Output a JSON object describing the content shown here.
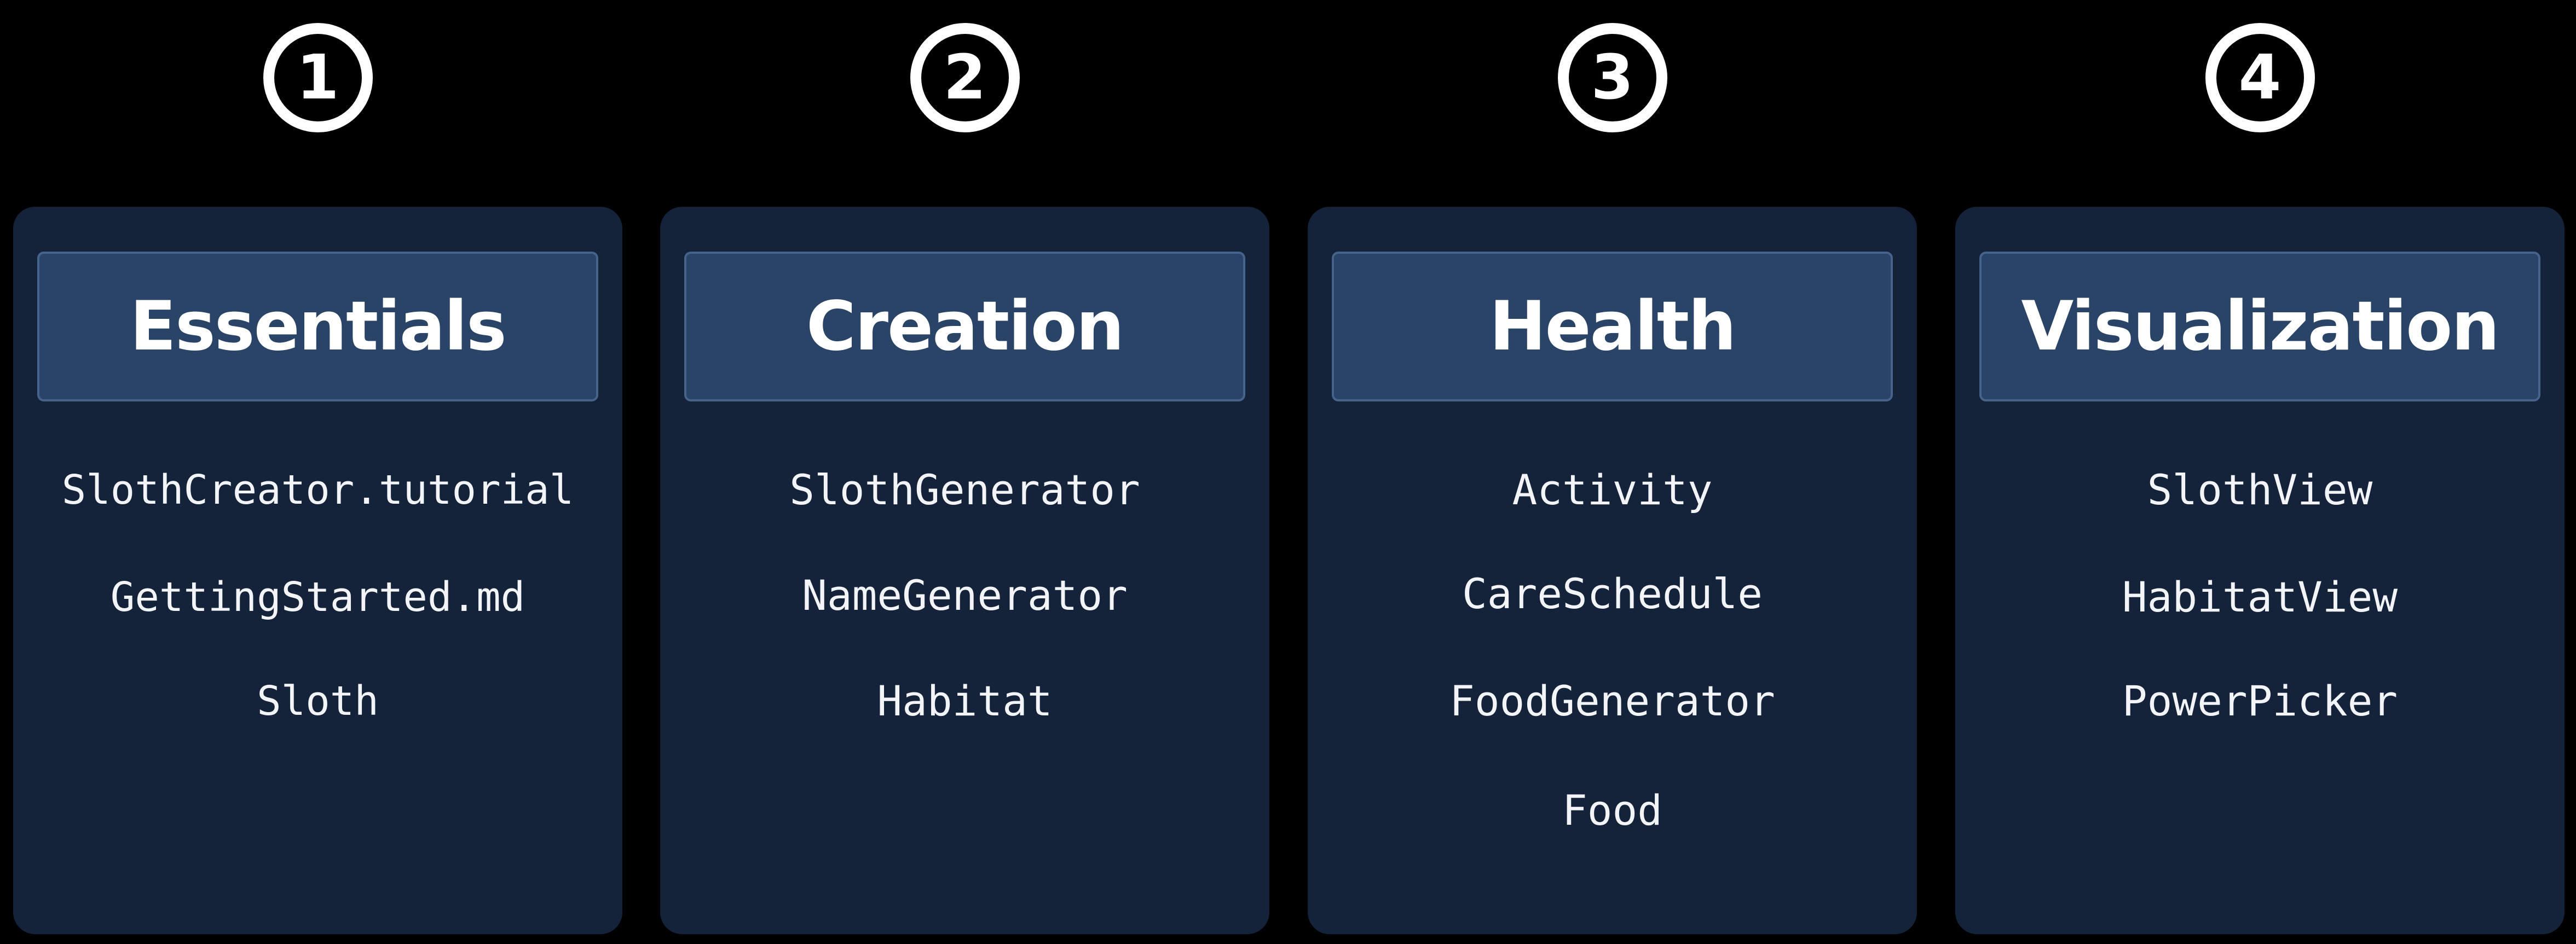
{
  "steps": [
    {
      "number": "1",
      "title": "Essentials",
      "items": [
        "SlothCreator.tutorial",
        "GettingStarted.md",
        "Sloth"
      ]
    },
    {
      "number": "2",
      "title": "Creation",
      "items": [
        "SlothGenerator",
        "NameGenerator",
        "Habitat"
      ]
    },
    {
      "number": "3",
      "title": "Health",
      "items": [
        "Activity",
        "CareSchedule",
        "FoodGenerator",
        "Food"
      ]
    },
    {
      "number": "4",
      "title": "Visualization",
      "items": [
        "SlothView",
        "HabitatView",
        "PowerPicker"
      ]
    }
  ],
  "colors": {
    "background": "#000000",
    "card": "#15233a",
    "header": "#2a4468",
    "header_border": "#46638c",
    "text": "#ffffff"
  }
}
